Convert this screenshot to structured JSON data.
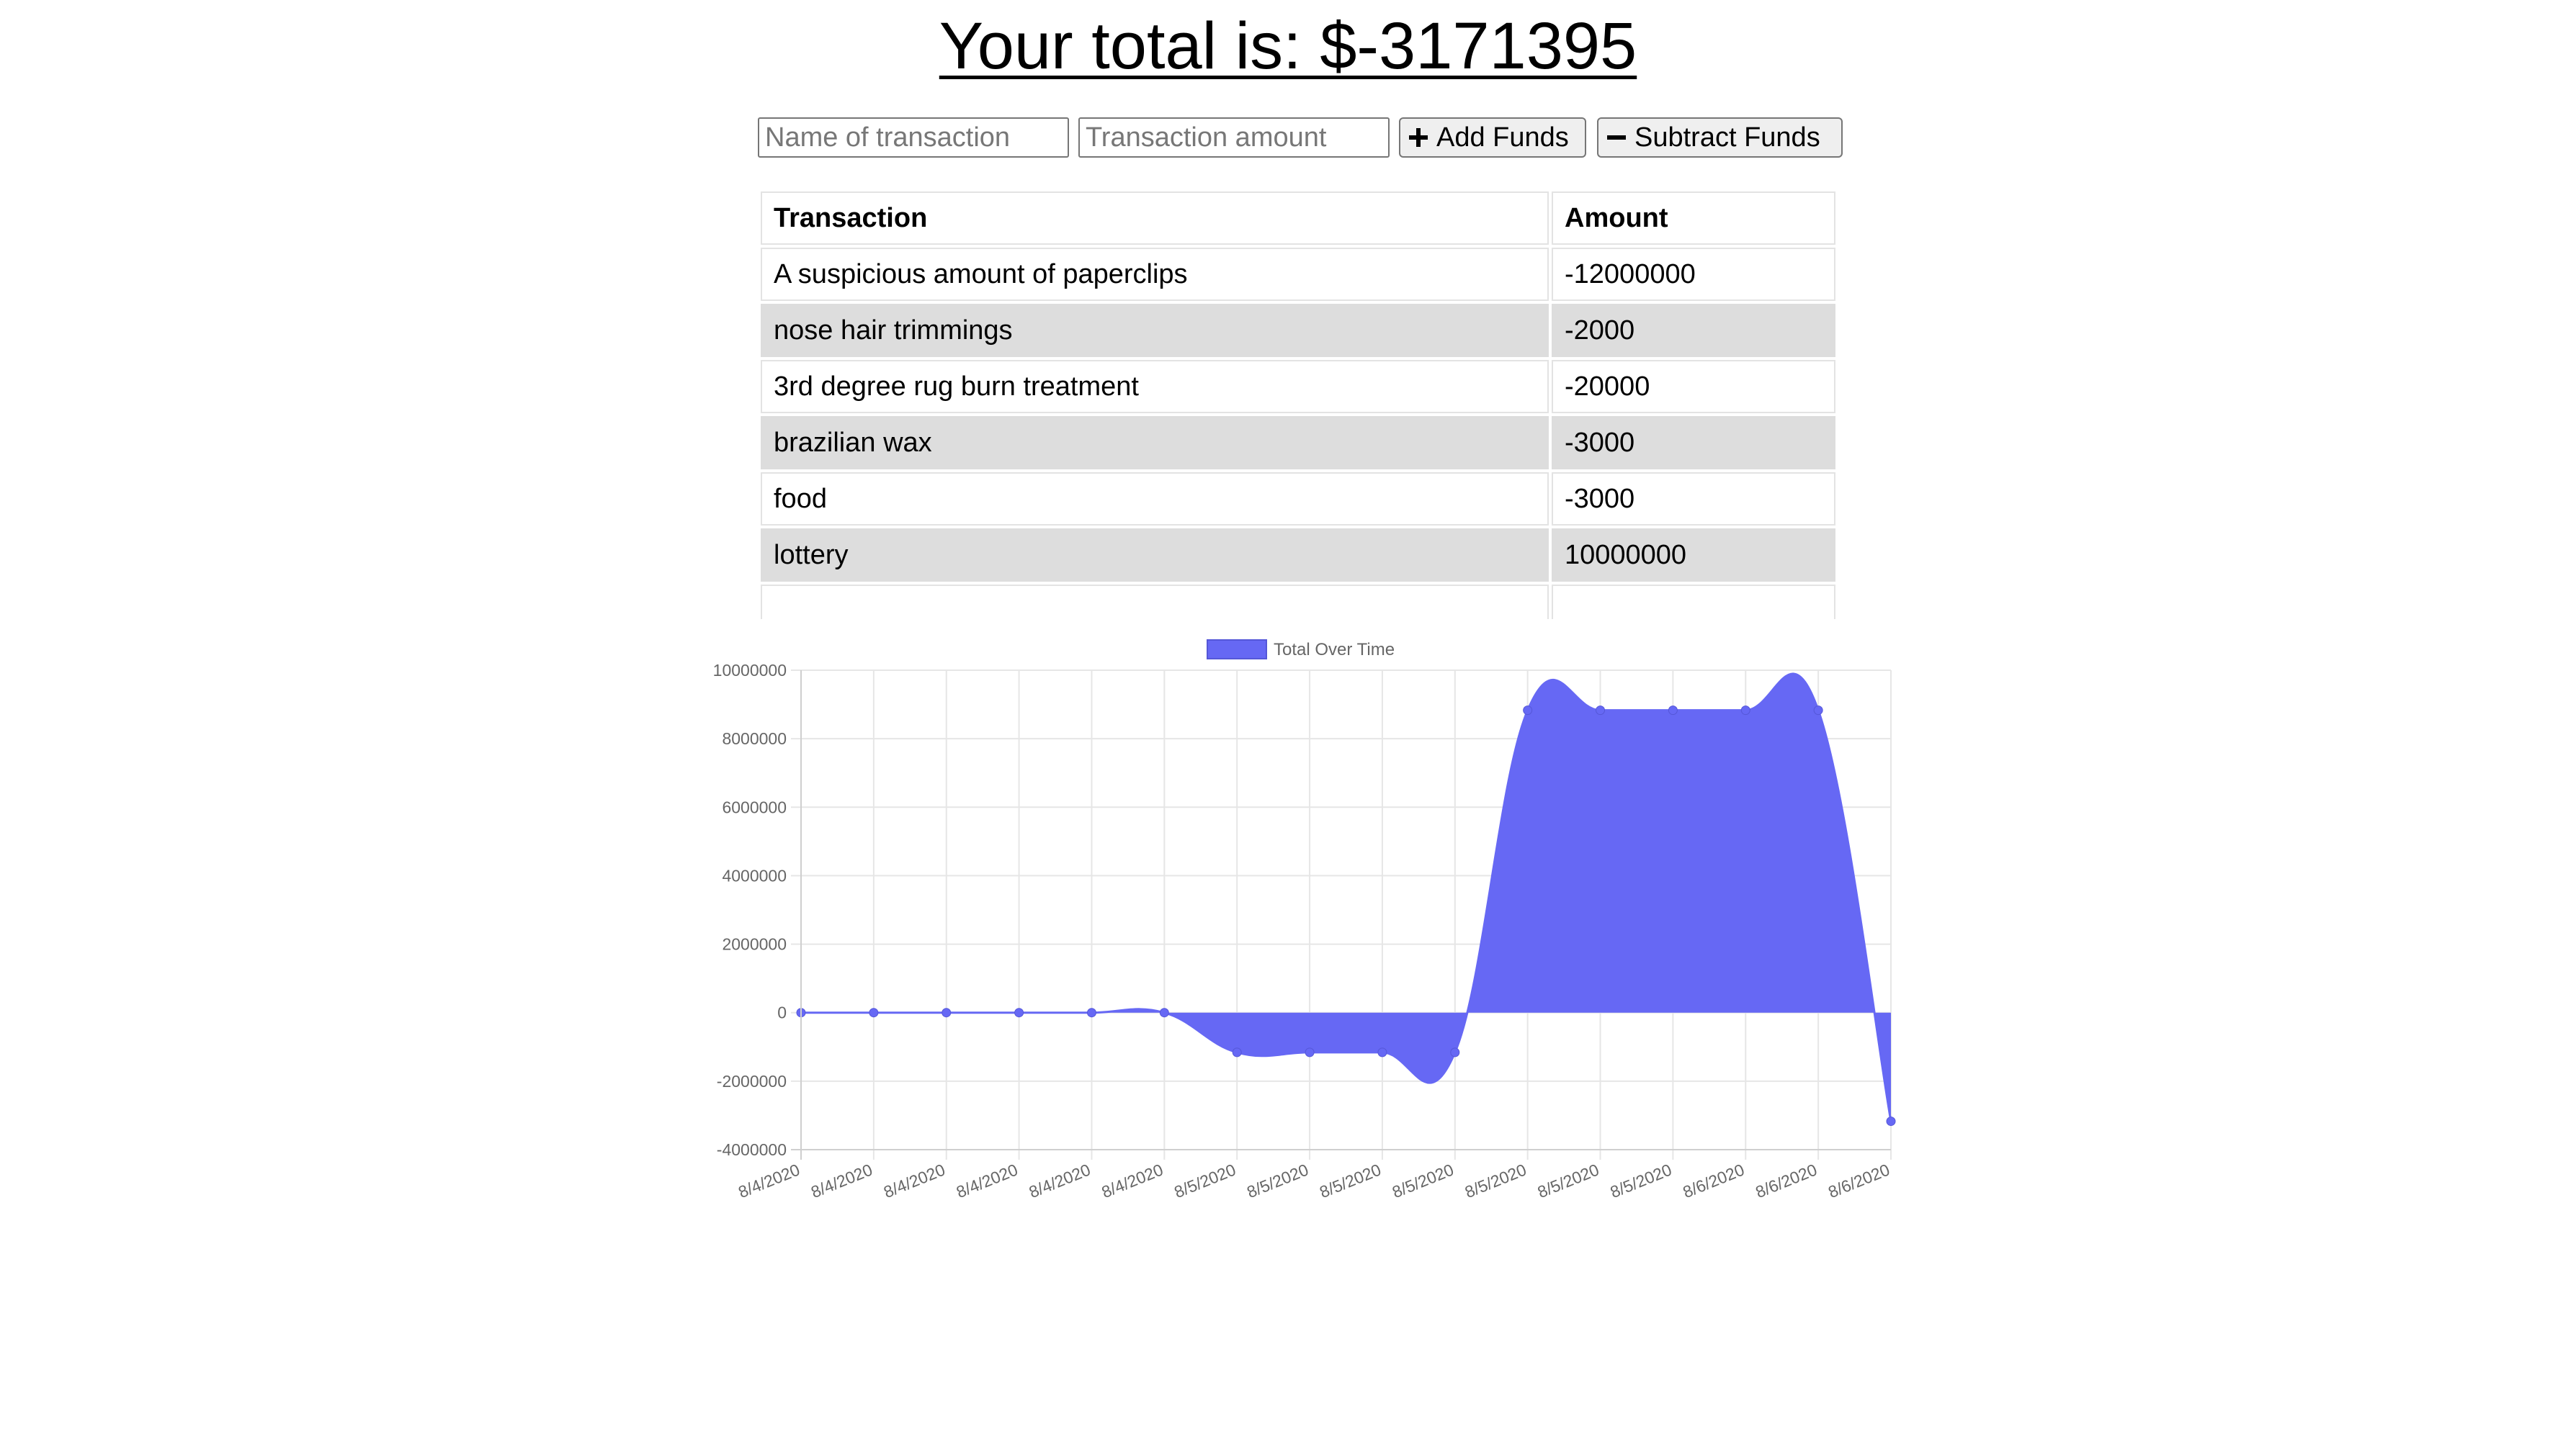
{
  "header": {
    "total_text": "Your total is: $-3171395"
  },
  "form": {
    "name_placeholder": "Name of transaction",
    "amount_placeholder": "Transaction amount",
    "add_label": "Add Funds",
    "subtract_label": "Subtract Funds",
    "add_icon": "plus-icon",
    "subtract_icon": "minus-icon"
  },
  "table": {
    "headers": [
      "Transaction",
      "Amount"
    ],
    "rows": [
      {
        "name": "A suspicious amount of paperclips",
        "amount": "-12000000"
      },
      {
        "name": "nose hair trimmings",
        "amount": "-2000"
      },
      {
        "name": "3rd degree rug burn treatment",
        "amount": "-20000"
      },
      {
        "name": "brazilian wax",
        "amount": "-3000"
      },
      {
        "name": "food",
        "amount": "-3000"
      },
      {
        "name": "lottery",
        "amount": "10000000"
      }
    ]
  },
  "chart_data": {
    "type": "area",
    "title": "",
    "legend": "top",
    "xlabel": "",
    "ylabel": "",
    "ylim": [
      -4000000,
      10000000
    ],
    "yticks": [
      10000000,
      8000000,
      6000000,
      4000000,
      2000000,
      0,
      -2000000,
      -4000000
    ],
    "grid": true,
    "categories": [
      "8/4/2020",
      "8/4/2020",
      "8/4/2020",
      "8/4/2020",
      "8/4/2020",
      "8/4/2020",
      "8/5/2020",
      "8/5/2020",
      "8/5/2020",
      "8/5/2020",
      "8/5/2020",
      "8/5/2020",
      "8/5/2020",
      "8/6/2020",
      "8/6/2020",
      "8/6/2020"
    ],
    "series": [
      {
        "name": "Total Over Time",
        "color": "#6668f4",
        "values": [
          0,
          0,
          0,
          0,
          0,
          0,
          -1160000,
          -1160000,
          -1160000,
          -1160000,
          8830000,
          8830000,
          8830000,
          8830000,
          8830000,
          -3171395
        ]
      }
    ]
  }
}
